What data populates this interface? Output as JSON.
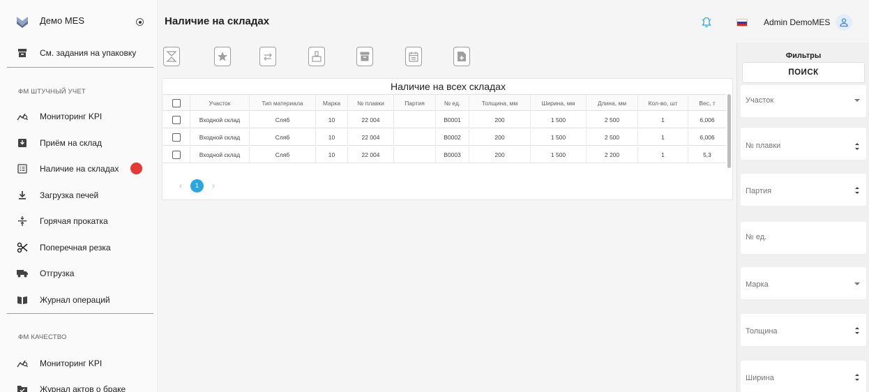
{
  "sidebar": {
    "brand": "Демо MES",
    "top_items": [
      {
        "label": "См. задания на упаковку"
      }
    ],
    "sections": [
      {
        "title": "ФМ ШТУЧНЫЙ УЧЕТ",
        "items": [
          {
            "label": "Мониторинг KPI"
          },
          {
            "label": "Приём на склад"
          },
          {
            "label": "Наличие на складах"
          },
          {
            "label": "Загрузка печей"
          },
          {
            "label": "Горячая прокатка"
          },
          {
            "label": "Поперечная резка"
          },
          {
            "label": "Отгрузка"
          },
          {
            "label": "Журнал операций"
          }
        ]
      },
      {
        "title": "ФМ КАЧЕСТВО",
        "items": [
          {
            "label": "Мониторинг KPI"
          },
          {
            "label": "Журнал актов о браке"
          }
        ]
      }
    ],
    "active_color": "#e53935"
  },
  "header": {
    "title": "Наличие на складах",
    "user": "Admin DemoMES"
  },
  "toolbar": {
    "icons": [
      "scales-icon",
      "star-icon",
      "transfer-icon",
      "weight-icon",
      "archive-icon",
      "calendar-icon",
      "add-document-icon"
    ]
  },
  "table": {
    "title": "Наличие на всех складах",
    "columns": [
      "Участок",
      "Тип материала",
      "Марка",
      "№ плавки",
      "Партия",
      "№ ед.",
      "Толщина, мм",
      "Ширина, мм",
      "Длина, мм",
      "Кол-во, шт",
      "Вес, т"
    ],
    "rows": [
      [
        "Входной склад",
        "Сляб",
        "10",
        "22 004",
        "",
        "B0001",
        "200",
        "1 500",
        "2 500",
        "1",
        "6,006"
      ],
      [
        "Входной склад",
        "Сляб",
        "10",
        "22 004",
        "",
        "B0002",
        "200",
        "1 500",
        "2 500",
        "1",
        "6,006"
      ],
      [
        "Входной склад",
        "Сляб",
        "10",
        "22 004",
        "",
        "B0003",
        "200",
        "1 500",
        "2 200",
        "1",
        "5,3"
      ]
    ],
    "pager": {
      "current": "1",
      "prev": "‹",
      "next": "›"
    }
  },
  "filters": {
    "title": "Фильтры",
    "search_label": "ПОИСК",
    "fields": [
      {
        "label": "Участок",
        "kind": "select"
      },
      {
        "label": "№ плавки",
        "kind": "spin"
      },
      {
        "label": "Партия",
        "kind": "spin"
      },
      {
        "label": "№ ед.",
        "kind": "text"
      },
      {
        "label": "Марка",
        "kind": "select"
      },
      {
        "label": "Толщина",
        "kind": "spin"
      },
      {
        "label": "Ширина",
        "kind": "spin"
      }
    ]
  },
  "colors": {
    "accent": "#29a8e0",
    "active": "#e53935"
  }
}
